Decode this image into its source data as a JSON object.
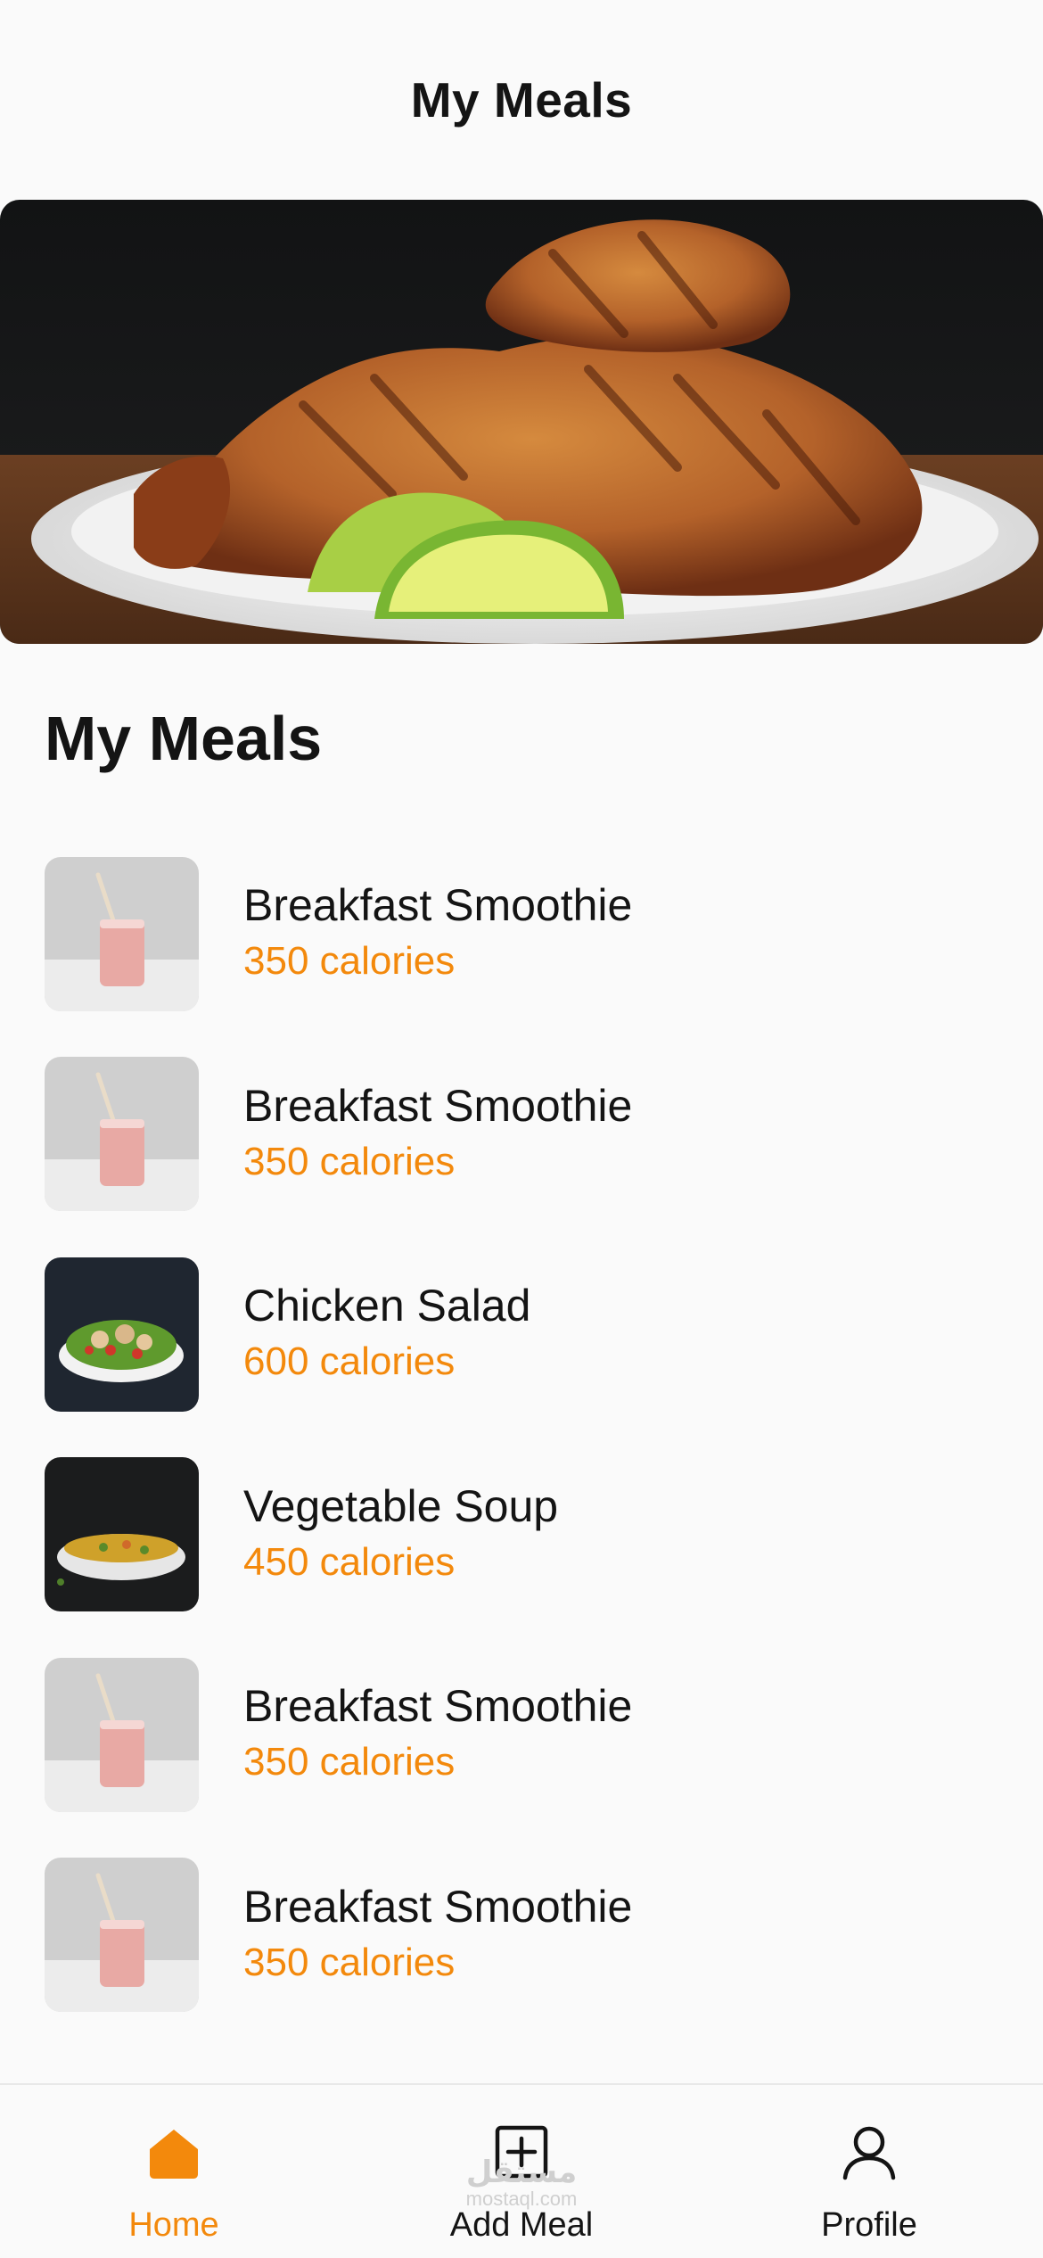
{
  "header": {
    "title": "My Meals"
  },
  "hero": {
    "image": "grilled-chicken-plate-with-lime"
  },
  "section": {
    "title": "My Meals"
  },
  "meals": [
    {
      "name": "Breakfast Smoothie",
      "calories": "350 calories",
      "image": "smoothie-glass"
    },
    {
      "name": "Breakfast Smoothie",
      "calories": "350 calories",
      "image": "smoothie-glass"
    },
    {
      "name": "Chicken Salad",
      "calories": "600 calories",
      "image": "salad-bowl"
    },
    {
      "name": "Vegetable Soup",
      "calories": "450 calories",
      "image": "soup-bowl"
    },
    {
      "name": "Breakfast Smoothie",
      "calories": "350 calories",
      "image": "smoothie-glass"
    },
    {
      "name": "Breakfast Smoothie",
      "calories": "350 calories",
      "image": "smoothie-glass"
    }
  ],
  "nav": {
    "home": {
      "label": "Home",
      "icon": "home-icon",
      "active": true
    },
    "add_meal": {
      "label": "Add Meal",
      "icon": "add-square-icon",
      "active": false
    },
    "profile": {
      "label": "Profile",
      "icon": "user-icon",
      "active": false
    }
  },
  "watermark": {
    "logo_text": "مستقل",
    "url": "mostaql.com"
  },
  "colors": {
    "accent": "#f3890c",
    "text": "#141414",
    "background": "#fafafa"
  }
}
